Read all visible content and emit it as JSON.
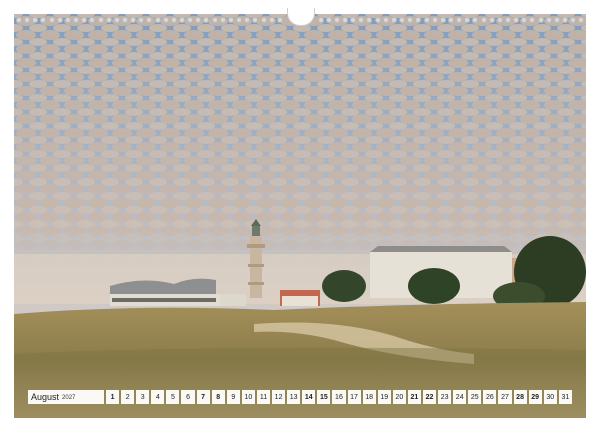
{
  "calendar": {
    "month": "August",
    "year": "2027",
    "days": [
      {
        "n": "1",
        "weekend": true
      },
      {
        "n": "2",
        "weekend": false
      },
      {
        "n": "3",
        "weekend": false
      },
      {
        "n": "4",
        "weekend": false
      },
      {
        "n": "5",
        "weekend": false
      },
      {
        "n": "6",
        "weekend": false
      },
      {
        "n": "7",
        "weekend": true
      },
      {
        "n": "8",
        "weekend": true
      },
      {
        "n": "9",
        "weekend": false
      },
      {
        "n": "10",
        "weekend": false
      },
      {
        "n": "11",
        "weekend": false
      },
      {
        "n": "12",
        "weekend": false
      },
      {
        "n": "13",
        "weekend": false
      },
      {
        "n": "14",
        "weekend": true
      },
      {
        "n": "15",
        "weekend": true
      },
      {
        "n": "16",
        "weekend": false
      },
      {
        "n": "17",
        "weekend": false
      },
      {
        "n": "18",
        "weekend": false
      },
      {
        "n": "19",
        "weekend": false
      },
      {
        "n": "20",
        "weekend": false
      },
      {
        "n": "21",
        "weekend": true
      },
      {
        "n": "22",
        "weekend": true
      },
      {
        "n": "23",
        "weekend": false
      },
      {
        "n": "24",
        "weekend": false
      },
      {
        "n": "25",
        "weekend": false
      },
      {
        "n": "26",
        "weekend": false
      },
      {
        "n": "27",
        "weekend": false
      },
      {
        "n": "28",
        "weekend": true
      },
      {
        "n": "29",
        "weekend": true
      },
      {
        "n": "30",
        "weekend": false
      },
      {
        "n": "31",
        "weekend": false
      }
    ]
  },
  "colors": {
    "sky_top": "#7f9dbf",
    "sky_bottom": "#e7d6c2",
    "cloud": "#c9b2a0",
    "dune_grass": "#9c8a5c",
    "building_white": "#e6e1d6",
    "tree": "#33452a"
  }
}
